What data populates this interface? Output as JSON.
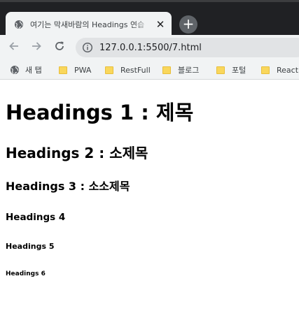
{
  "browser": {
    "tab": {
      "title": "여기는 막새바람의 Headings 연습",
      "close_glyph": "✕",
      "favicon": "globe-icon"
    },
    "new_tab_glyph": "+",
    "toolbar": {
      "url": "127.0.0.1:5500/7.html",
      "info_icon": "info-icon"
    },
    "bookmarks": [
      {
        "label": "새 탭",
        "icon": "globe-icon"
      },
      {
        "label": "PWA",
        "icon": "folder-icon"
      },
      {
        "label": "RestFull",
        "icon": "folder-icon"
      },
      {
        "label": "블로그",
        "icon": "folder-icon"
      },
      {
        "label": "포털",
        "icon": "folder-icon"
      },
      {
        "label": "React",
        "icon": "folder-icon"
      }
    ]
  },
  "page": {
    "h1": "Headings 1 : 제목",
    "h2": "Headings 2 : 소제목",
    "h3": "Headings 3 : 소소제목",
    "h4": "Headings 4",
    "h5": "Headings 5",
    "h6": "Headings 6"
  },
  "colors": {
    "frame": "#202124",
    "toolbar": "#f1f3f4",
    "omnibox": "#e1e3e5",
    "folder": "#f9d75c"
  }
}
